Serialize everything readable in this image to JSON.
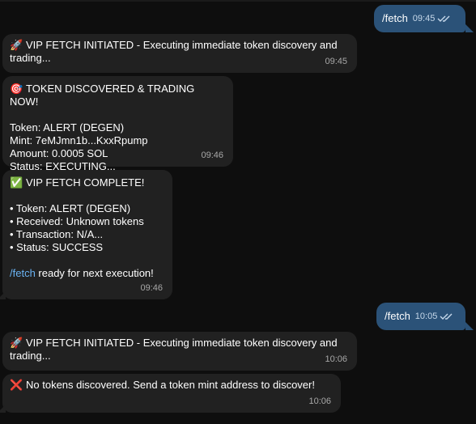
{
  "messages": [
    {
      "id": "m1",
      "direction": "out",
      "text": "/fetch",
      "time": "09:45",
      "status": "read"
    },
    {
      "id": "m2",
      "direction": "in",
      "icon": "rocket-icon",
      "lines": [
        "VIP FETCH INITIATED - Executing immediate token discovery and",
        "trading..."
      ],
      "time": "09:45"
    },
    {
      "id": "m3",
      "direction": "in",
      "icon": "target-icon",
      "lines": [
        "TOKEN DISCOVERED & TRADING NOW!",
        "",
        "Token: ALERT (DEGEN)",
        "Mint: 7eMJmn1b...KxxRpump",
        "Amount: 0.0005 SOL",
        "Status: EXECUTING..."
      ],
      "time": "09:46"
    },
    {
      "id": "m4",
      "direction": "in",
      "icon": "check-mark-icon",
      "lines": [
        "VIP FETCH COMPLETE!",
        "",
        "• Token: ALERT (DEGEN)",
        "• Received: Unknown tokens",
        "• Transaction: N/A...",
        "• Status: SUCCESS",
        ""
      ],
      "command_link": "/fetch",
      "command_suffix": " ready for next execution!",
      "time": "09:46"
    },
    {
      "id": "m5",
      "direction": "out",
      "text": "/fetch",
      "time": "10:05",
      "status": "read"
    },
    {
      "id": "m6",
      "direction": "in",
      "icon": "rocket-icon",
      "lines": [
        "VIP FETCH INITIATED - Executing immediate token discovery and",
        "trading..."
      ],
      "time": "10:06"
    },
    {
      "id": "m7",
      "direction": "in",
      "icon": "cross-mark-icon",
      "lines": [
        "No tokens discovered. Send a token mint address to discover!"
      ],
      "time": "10:06"
    }
  ],
  "colors": {
    "background": "#0e0e0e",
    "incoming_bubble": "#212121",
    "outgoing_bubble": "#2b5278",
    "link": "#6ab3f3",
    "timestamp": "#a8a8a8"
  }
}
